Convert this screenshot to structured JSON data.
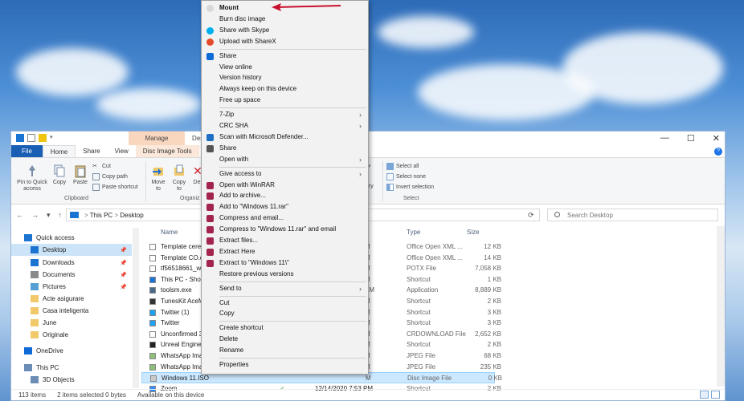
{
  "explorer": {
    "manage_tab": "Manage",
    "desktop_tab_fragment": "Desk",
    "window_buttons": [
      "—",
      "☐",
      "✕"
    ],
    "ribbon_tabs": [
      "File",
      "Home",
      "Share",
      "View",
      "Disc Image Tools"
    ],
    "help": "?",
    "clipboard": {
      "pin": "Pin to Quick access",
      "copy": "Copy",
      "paste": "Paste",
      "cut": "Cut",
      "copy_path": "Copy path",
      "paste_shortcut": "Paste shortcut",
      "label": "Clipboard"
    },
    "organize": {
      "move_to": "Move to",
      "copy_to": "Copy to",
      "delete_fragment": "De",
      "label": "Organiz"
    },
    "open_fragment": "ory",
    "select": {
      "select_all": "Select all",
      "select_none": "Select none",
      "invert": "Invert selection",
      "label": "Select"
    },
    "address": {
      "path": [
        "This PC",
        "Desktop"
      ],
      "separator": ">",
      "search_placeholder": "Search Desktop"
    },
    "nav": [
      {
        "label": "Quick access",
        "pinned": false
      },
      {
        "label": "Desktop",
        "pinned": true,
        "selected": true
      },
      {
        "label": "Downloads",
        "pinned": true
      },
      {
        "label": "Documents",
        "pinned": true
      },
      {
        "label": "Pictures",
        "pinned": true
      },
      {
        "label": "Acte asigurare",
        "pinned": false
      },
      {
        "label": "Casa inteligenta",
        "pinned": false
      },
      {
        "label": "June",
        "pinned": false
      },
      {
        "label": "Originale",
        "pinned": false
      },
      {
        "label": "OneDrive",
        "pinned": false
      },
      {
        "label": "This PC",
        "pinned": false
      },
      {
        "label": "3D Objects",
        "pinned": false
      }
    ],
    "columns": {
      "name": "Name",
      "type": "Type",
      "size": "Size"
    },
    "files": [
      {
        "name": "Template cerere",
        "date_frag": "M",
        "type": "Office Open XML ...",
        "size": "12 KB"
      },
      {
        "name": "Template CO.docx",
        "date_frag": "M",
        "type": "Office Open XML ...",
        "size": "14 KB"
      },
      {
        "name": "tf56518661_win32",
        "date_frag": "M",
        "type": "POTX File",
        "size": "7,058 KB"
      },
      {
        "name": "This PC - Shortcut",
        "date_frag": "M",
        "type": "Shortcut",
        "size": "1 KB"
      },
      {
        "name": "toolsm.exe",
        "date_frag": "AM",
        "type": "Application",
        "size": "8,889 KB"
      },
      {
        "name": "TunesKit AceMovi",
        "date_frag": "M",
        "type": "Shortcut",
        "size": "2 KB"
      },
      {
        "name": "Twitter (1)",
        "date_frag": "M",
        "type": "Shortcut",
        "size": "3 KB"
      },
      {
        "name": "Twitter",
        "date_frag": "M",
        "type": "Shortcut",
        "size": "3 KB"
      },
      {
        "name": "Unconfirmed 3",
        "date_frag": "M",
        "type": "CRDOWNLOAD File",
        "size": "2,652 KB"
      },
      {
        "name": "Unreal Engine",
        "date_frag": "M",
        "type": "Shortcut",
        "size": "2 KB"
      },
      {
        "name": "WhatsApp Image",
        "date_frag": "M",
        "type": "JPEG File",
        "size": "68 KB"
      },
      {
        "name": "WhatsApp Image",
        "date_frag": "M",
        "type": "JPEG File",
        "size": "235 KB"
      },
      {
        "name": "Windows 11.ISO",
        "date_frag": "M",
        "type": "Disc Image File",
        "size": "0 KB",
        "selected": true
      },
      {
        "name": "Zoom",
        "date": "12/14/2020 7:53 PM",
        "check": "✓",
        "type": "Shortcut",
        "size": "2 KB"
      }
    ],
    "status": {
      "items": "113 items",
      "selected": "2 items selected  0 bytes",
      "availability": "Available on this device"
    }
  },
  "context_menu": {
    "items": [
      {
        "label": "Mount",
        "bold": true,
        "icon": "disc-icon",
        "color": "#d8d8d8"
      },
      {
        "label": "Burn disc image"
      },
      {
        "label": "Share with Skype",
        "icon": "skype-icon",
        "color": "#00aff0"
      },
      {
        "label": "Upload with ShareX",
        "icon": "sharex-icon",
        "color": "#e34b2a"
      },
      {
        "sep": true
      },
      {
        "label": "Share",
        "icon": "onedrive-icon",
        "color": "#0f6cd6"
      },
      {
        "label": "View online"
      },
      {
        "label": "Version history"
      },
      {
        "label": "Always keep on this device"
      },
      {
        "label": "Free up space"
      },
      {
        "sep": true
      },
      {
        "label": "7-Zip",
        "submenu": true
      },
      {
        "label": "CRC SHA",
        "submenu": true
      },
      {
        "label": "Scan with Microsoft Defender...",
        "icon": "defender-icon",
        "color": "#1f6fc5"
      },
      {
        "label": "Share",
        "icon": "share-icon",
        "color": "#555555"
      },
      {
        "label": "Open with",
        "submenu": true
      },
      {
        "sep": true
      },
      {
        "label": "Give access to",
        "submenu": true
      },
      {
        "label": "Open with WinRAR",
        "icon": "winrar-icon",
        "color": "#a3254d"
      },
      {
        "label": "Add to archive...",
        "icon": "winrar-icon",
        "color": "#a3254d"
      },
      {
        "label": "Add to \"Windows 11.rar\"",
        "icon": "winrar-icon",
        "color": "#a3254d"
      },
      {
        "label": "Compress and email...",
        "icon": "winrar-icon",
        "color": "#a3254d"
      },
      {
        "label": "Compress to \"Windows 11.rar\" and email",
        "icon": "winrar-icon",
        "color": "#a3254d"
      },
      {
        "label": "Extract files...",
        "icon": "winrar-icon",
        "color": "#a3254d"
      },
      {
        "label": "Extract Here",
        "icon": "winrar-icon",
        "color": "#a3254d"
      },
      {
        "label": "Extract to \"Windows 11\\\"",
        "icon": "winrar-icon",
        "color": "#a3254d"
      },
      {
        "label": "Restore previous versions"
      },
      {
        "sep": true
      },
      {
        "label": "Send to",
        "submenu": true
      },
      {
        "sep": true
      },
      {
        "label": "Cut"
      },
      {
        "label": "Copy"
      },
      {
        "sep": true
      },
      {
        "label": "Create shortcut"
      },
      {
        "label": "Delete"
      },
      {
        "label": "Rename"
      },
      {
        "sep": true
      },
      {
        "label": "Properties"
      }
    ]
  },
  "colors": {
    "accent": "#1a5fb4",
    "arrow": "#c8102e",
    "selection": "#cce8ff"
  }
}
